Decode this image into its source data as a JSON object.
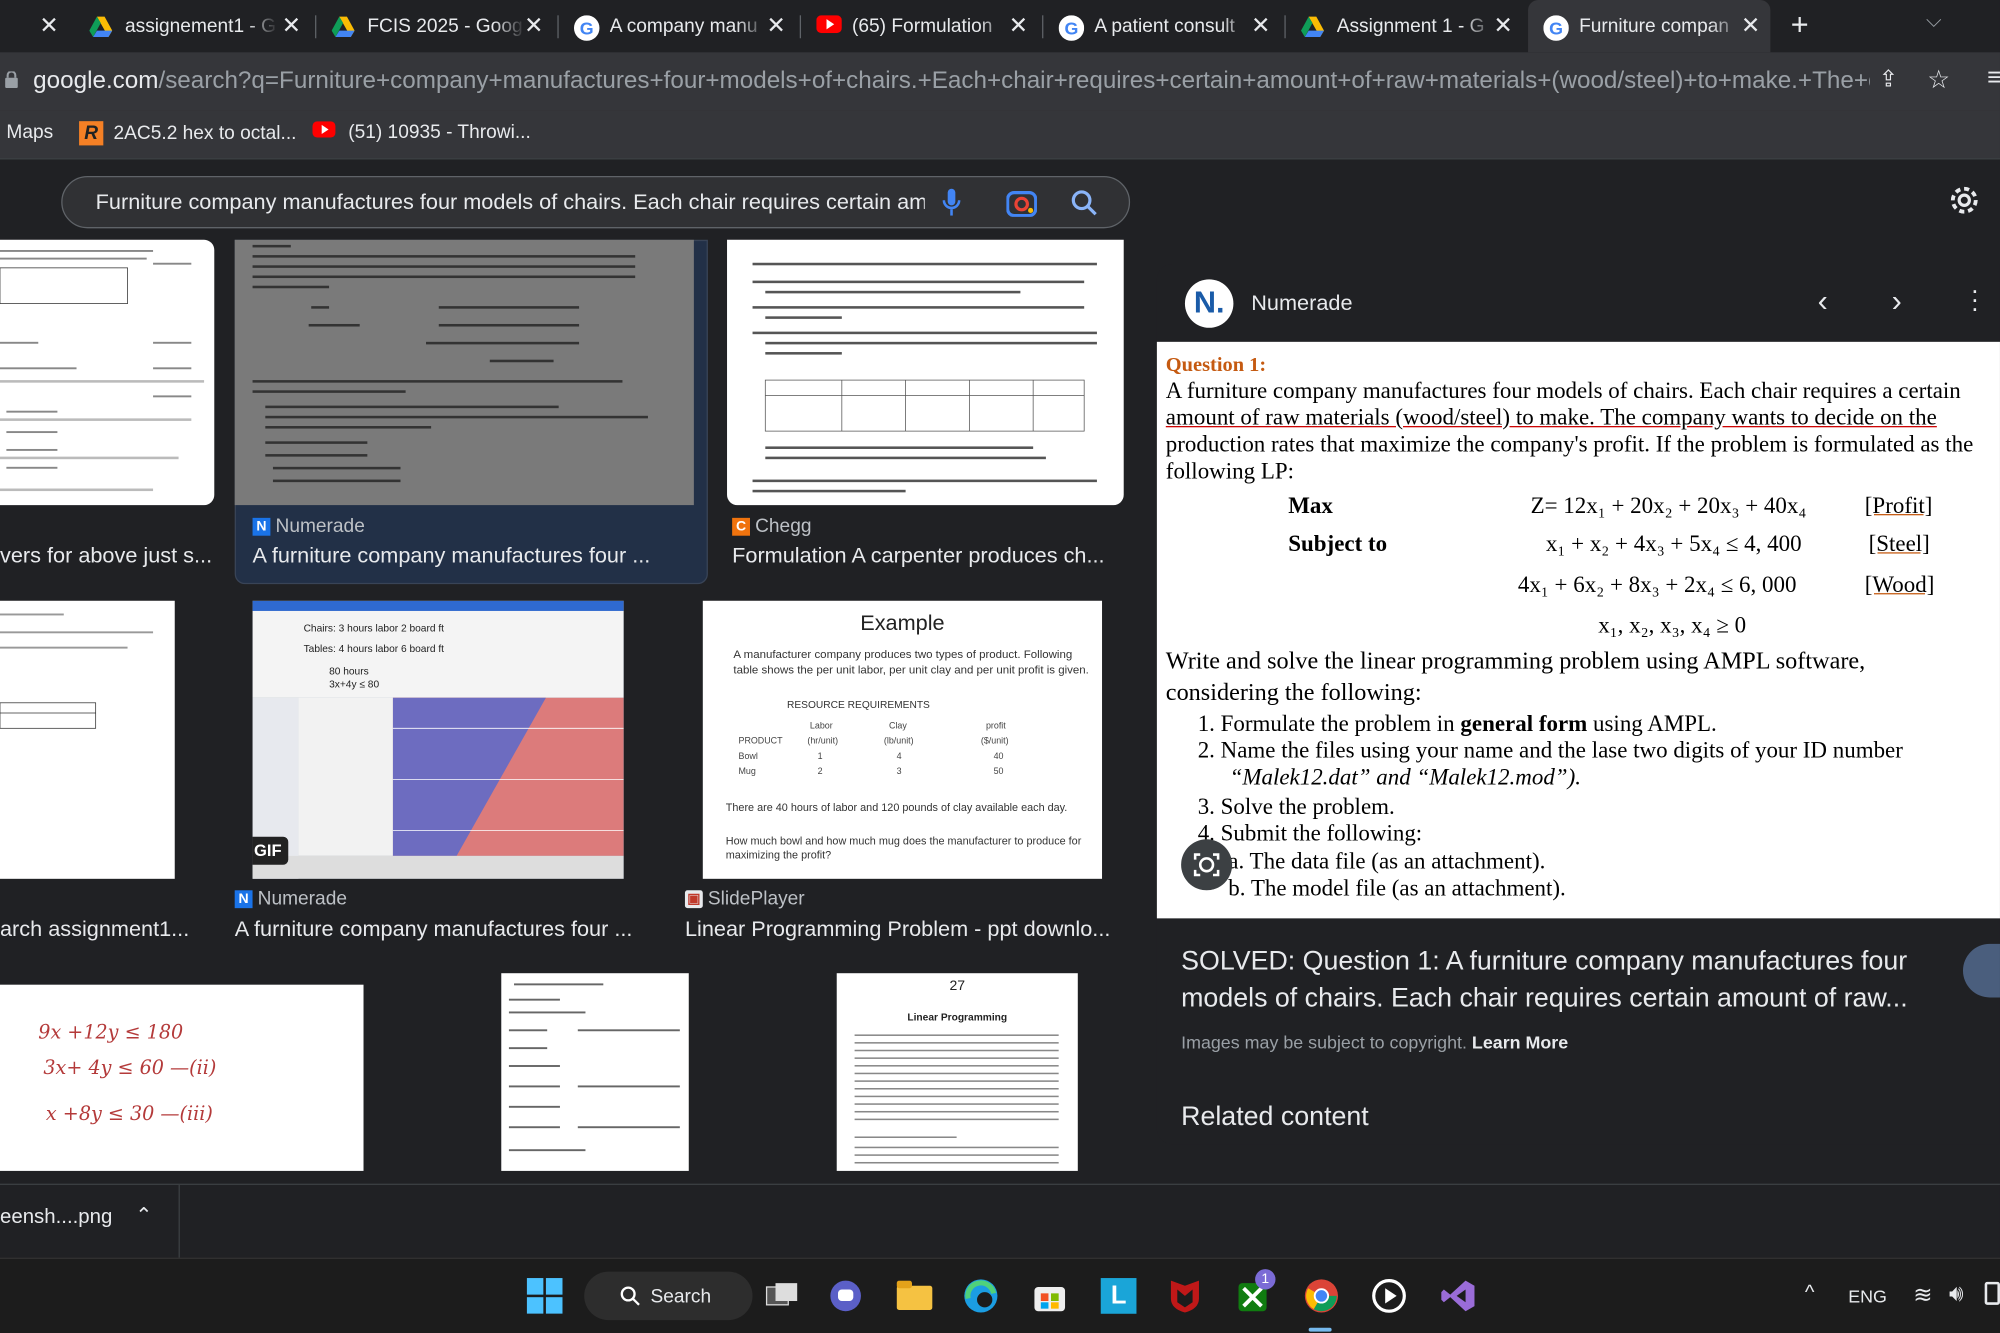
{
  "tabs": [
    {
      "title": "",
      "favicon": "close"
    },
    {
      "title": "assignement1 - G",
      "favicon": "google-drive-icon"
    },
    {
      "title": "FCIS 2025 - Goog",
      "favicon": "google-drive-icon"
    },
    {
      "title": "A company manu",
      "favicon": "google-icon"
    },
    {
      "title": "(65) Formulation",
      "favicon": "youtube-icon"
    },
    {
      "title": "A patient consult",
      "favicon": "google-icon"
    },
    {
      "title": "Assignment 1 - G",
      "favicon": "google-drive-icon"
    },
    {
      "title": "Furniture compan",
      "favicon": "google-icon"
    }
  ],
  "address": {
    "host": "google.com",
    "path": "/search?q=Furniture+company+manufactures+four+models+of+chairs.+Each+chair+requires+certain+amount+of+raw+materials+(wood/steel)+to+make.+The+company+wan..."
  },
  "bookmarks": [
    {
      "label": "Maps"
    },
    {
      "label": "2AC5.2 hex to octal..."
    },
    {
      "label": "(51) 10935 - Throwi..."
    }
  ],
  "search": {
    "query": "Furniture company manufactures four models of chairs. Each chair requires certain am"
  },
  "results": [
    {
      "source": "",
      "caption": "vers for above just s..."
    },
    {
      "source": "Numerade",
      "caption": "A furniture company manufactures four ..."
    },
    {
      "source": "Chegg",
      "caption": "Formulation A carpenter produces ch..."
    },
    {
      "source": "",
      "caption": "arch assignment1..."
    },
    {
      "source": "Numerade",
      "caption": "A furniture company manufactures four ..."
    },
    {
      "source": "SlidePlayer",
      "caption": "Linear Programming Problem - ppt downlo..."
    }
  ],
  "thumbs": {
    "example_title": "Example",
    "example_text": "A manufacturer company produces two types of product. Following table shows the per unit labor, per unit clay and per unit profit is given.",
    "resource": "RESOURCE REQUIREMENTS",
    "example_footer1": "There are 40 hours of labor and 120 pounds of clay available each day.",
    "example_footer2": "How much bowl and how much mug does the manufacturer to produce for maximizing the profit?",
    "gif": "GIF",
    "page27": "27",
    "lp_title": "Linear Programming",
    "hand1": "9x +12y ≤ 180",
    "hand2": "3x+ 4y ≤ 60  —(ii)",
    "hand3": "x +8y ≤ 30  —(iii)"
  },
  "panel": {
    "site": "Numerade",
    "question_label": "Question 1:",
    "intro1": "A furniture company manufactures four models of chairs. Each chair requires a certain",
    "intro2": "amount of raw materials (wood/steel) to make. The company wants to decide on the",
    "intro3": "production rates that maximize the company's profit. If the problem is formulated as the",
    "intro4": "following LP:",
    "max_label": "Max",
    "objective": "Z= 12x₁ + 20x₂ + 20x₃ + 40x₄",
    "profit_tag": "[Profit]",
    "subject_label": "Subject to",
    "c1": "x₁ + x₂ + 4x₃ + 5x₄ ≤ 4, 400",
    "steel_tag": "[Steel]",
    "c2": "4x₁ + 6x₂ + 8x₃ + 2x₄ ≤ 6, 000",
    "wood_tag": "[Wood]",
    "c3": "x₁, x₂, x₃, x₄ ≥ 0",
    "write1": "Write and solve the linear programming problem using AMPL software,",
    "write2": "considering the following:",
    "item1a": "1. Formulate the problem in ",
    "item1b": "general form",
    "item1c": " using AMPL.",
    "item2": "2. Name the files using your name and the lase two digits of your ID number",
    "item2b": "“Malek12.dat” and “Malek12.mod”).",
    "item3": "3. Solve the problem.",
    "item4": "4. Submit the following:",
    "item4a": "a. The data file (as an attachment).",
    "item4b": "b. The model file (as an attachment).",
    "solved_title1": "SOLVED: Question 1: A furniture company manufactures four",
    "solved_title2": "models of chairs. Each chair requires certain amount of raw...",
    "copyright": "Images may be subject to copyright.",
    "learn_more": "Learn More",
    "related": "Related content"
  },
  "download": {
    "file": "eensh....png"
  },
  "taskbar": {
    "search": "Search",
    "lang": "ENG",
    "badge": "1"
  }
}
